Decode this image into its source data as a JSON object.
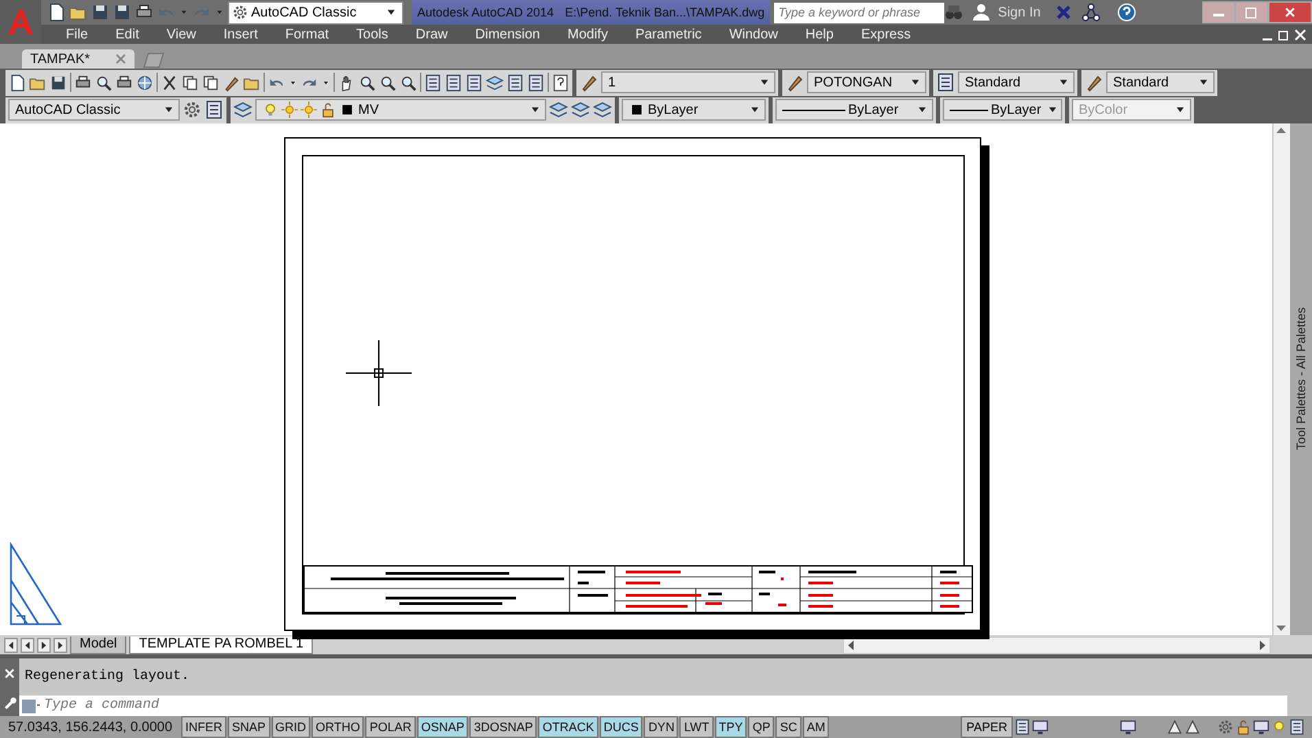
{
  "app": {
    "title": "Autodesk AutoCAD 2014",
    "file_path": "E:\\Pend. Teknik Ban...\\TAMPAK.dwg",
    "workspace": "AutoCAD Classic",
    "search": {
      "placeholder": "Type a keyword or phrase"
    },
    "sign_in": "Sign In"
  },
  "menu": [
    "File",
    "Edit",
    "View",
    "Insert",
    "Format",
    "Tools",
    "Draw",
    "Dimension",
    "Modify",
    "Parametric",
    "Window",
    "Help",
    "Express"
  ],
  "document_tabs": [
    {
      "label": "TAMPAK*",
      "selected": true
    }
  ],
  "styles_toolbar": {
    "text_style": "1",
    "dimension_style": "POTONGAN",
    "table_style": "Standard",
    "multileader_style": "Standard"
  },
  "workspace_toolbar": {
    "workspace": "AutoCAD Classic"
  },
  "layers_toolbar": {
    "layer": "MV"
  },
  "properties_toolbar": {
    "color_setting": "ByLayer",
    "linetype": "ByLayer",
    "lineweight": "ByLayer",
    "plot_style": {
      "text": "ByColor",
      "disabled": true
    }
  },
  "layout_tabs": [
    {
      "label": "Model",
      "selected": false
    },
    {
      "label": "TEMPLATE PA ROMBEL 1",
      "selected": true
    }
  ],
  "palette": {
    "title": "Tool Palettes - All Palettes"
  },
  "command": {
    "history": "Regenerating layout.",
    "placeholder": "Type a command"
  },
  "status_bar": {
    "coordinates": "57.0343, 156.2443, 0.0000",
    "space": "PAPER",
    "toggles": [
      {
        "label": "INFER",
        "on": false
      },
      {
        "label": "SNAP",
        "on": false
      },
      {
        "label": "GRID",
        "on": false
      },
      {
        "label": "ORTHO",
        "on": false
      },
      {
        "label": "POLAR",
        "on": false
      },
      {
        "label": "OSNAP",
        "on": true
      },
      {
        "label": "3DOSNAP",
        "on": false
      },
      {
        "label": "OTRACK",
        "on": true
      },
      {
        "label": "DUCS",
        "on": true
      },
      {
        "label": "DYN",
        "on": false
      },
      {
        "label": "LWT",
        "on": false
      },
      {
        "label": "TPY",
        "on": true
      },
      {
        "label": "QP",
        "on": false
      },
      {
        "label": "SC",
        "on": false
      },
      {
        "label": "AM",
        "on": false
      }
    ]
  }
}
